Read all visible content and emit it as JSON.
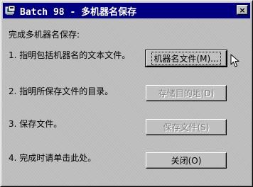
{
  "window": {
    "title": "Batch 98 - 多机器名保存",
    "close_glyph": "×"
  },
  "content": {
    "heading": "完成多机器名保存:",
    "steps": [
      {
        "label": "1. 指明包括机器名的文本文件。",
        "button": "机器名文件(M)...",
        "enabled": true
      },
      {
        "label": "2. 指明所保存文件的目录。",
        "button": "存储目的地(D)",
        "enabled": false
      },
      {
        "label": "3.   保存文件。",
        "button": "保存文件(S)",
        "enabled": false
      },
      {
        "label": "4.   完成时请单击此处。",
        "button": "关闭(O)",
        "enabled": true
      }
    ]
  },
  "colors": {
    "titlebar": "#000080",
    "face": "#c0c0c0",
    "disabled_text": "#808080"
  },
  "icons": {
    "title_icon": "batch-app-icon",
    "cursor": "mouse-pointer-icon"
  }
}
